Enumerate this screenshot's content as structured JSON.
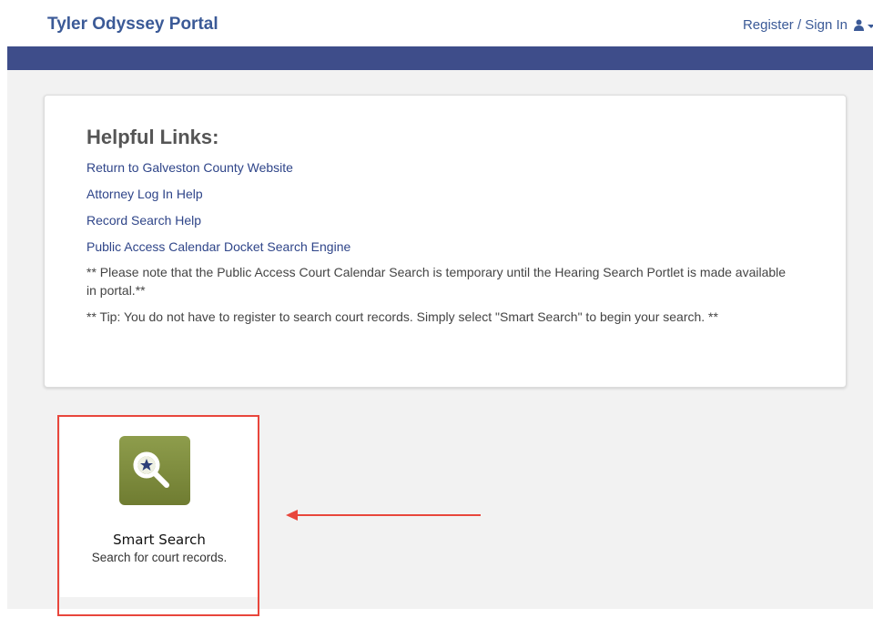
{
  "header": {
    "title": "Tyler Odyssey Portal",
    "signin_label": "Register / Sign In",
    "user_icon": "user-icon",
    "caret_icon": "chevron-down-icon"
  },
  "helpful_links": {
    "heading": "Helpful Links:",
    "links": [
      "Return to Galveston County Website",
      "Attorney Log In Help",
      "Record Search Help",
      "Public Access Calendar Docket Search Engine"
    ],
    "notes": [
      "** Please note that the Public Access Court Calendar Search is temporary until the Hearing Search Portlet is made available in portal.**",
      "** Tip: You do not have to register to search court records. Simply select \"Smart Search\" to begin your search. **"
    ]
  },
  "tiles": [
    {
      "title": "Smart Search",
      "description": "Search for court records.",
      "icon": "magnifier-star-icon"
    }
  ],
  "annotation": {
    "highlight_color": "#e8463c",
    "arrow_icon": "left-arrow-icon"
  },
  "colors": {
    "brand": "#3b5a97",
    "nav_bar": "#3e4d8a",
    "link": "#2f4589",
    "tile_icon_bg": "#7d8b3d"
  }
}
